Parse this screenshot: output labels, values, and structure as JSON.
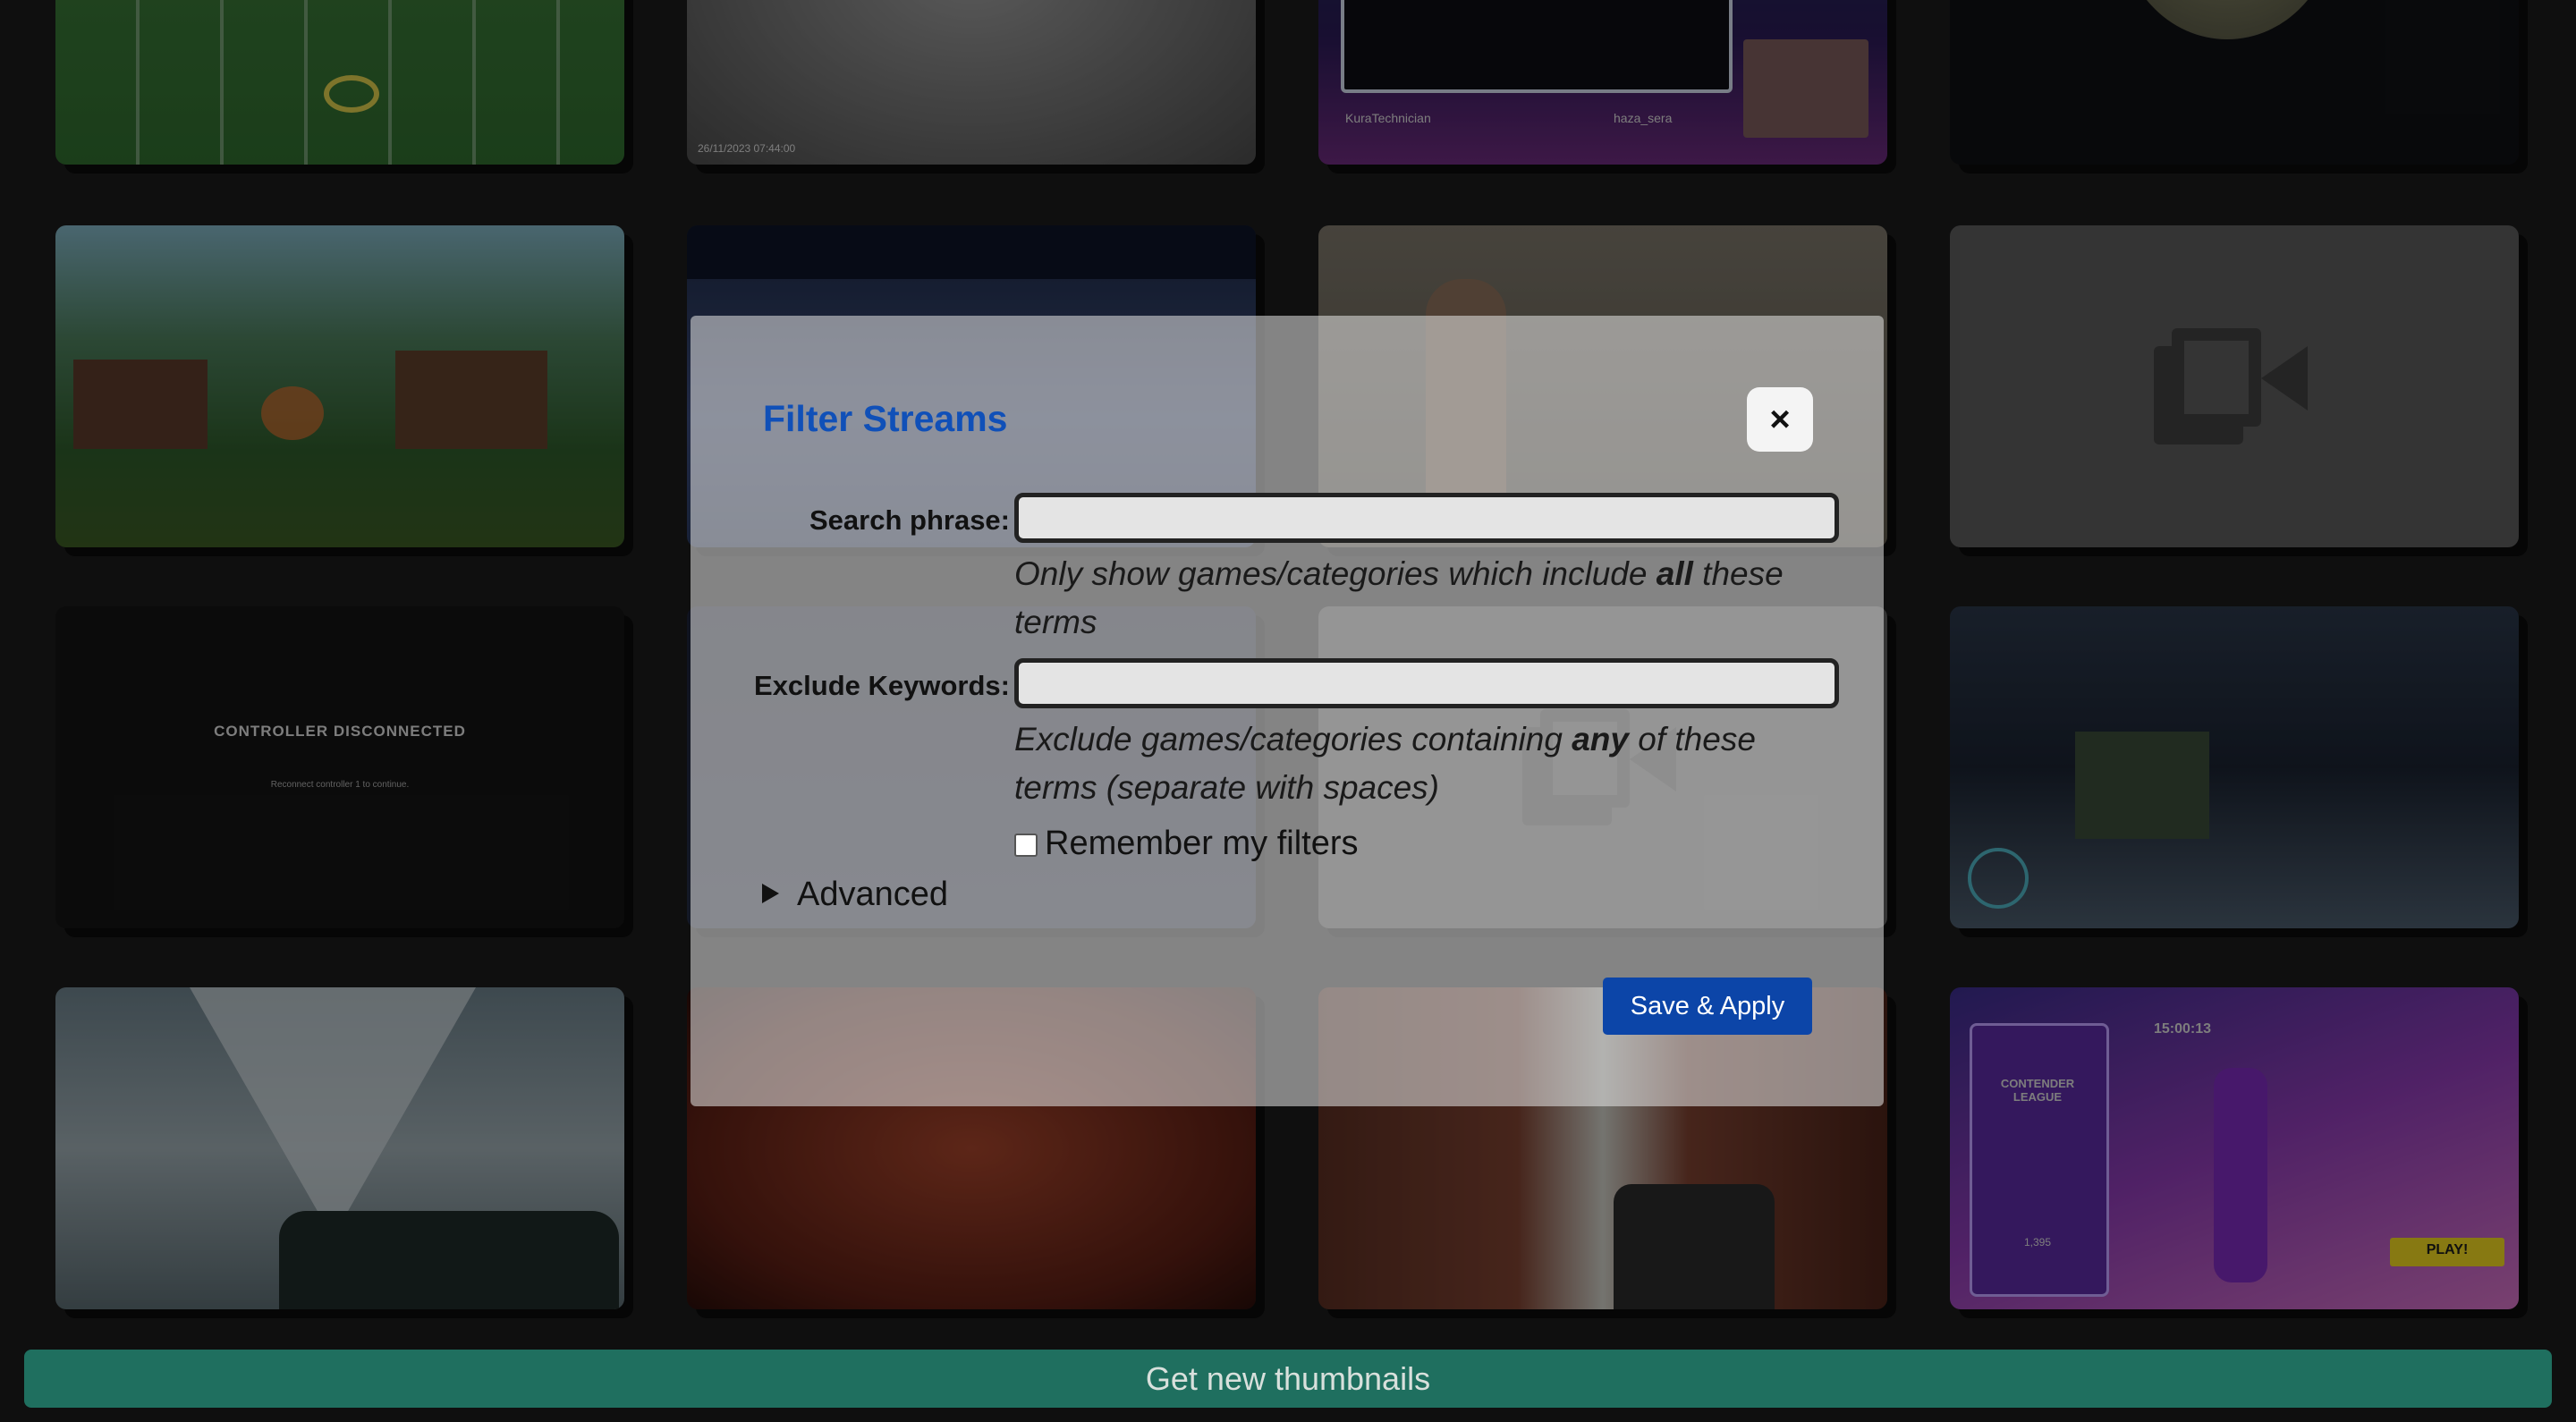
{
  "modal": {
    "title": "Filter Streams",
    "close_label": "×",
    "search_label": "Search phrase:",
    "search_value": "",
    "search_hint_pre": "Only show games/categories which include ",
    "search_hint_em": "all",
    "search_hint_post": " these terms",
    "exclude_label": "Exclude Keywords:",
    "exclude_value": "",
    "exclude_hint_pre": "Exclude games/categories containing ",
    "exclude_hint_em": "any",
    "exclude_hint_post": " of these terms (separate with spaces)",
    "remember_label": "Remember my filters",
    "remember_checked": false,
    "advanced_label": "Advanced",
    "save_label": "Save & Apply"
  },
  "footer": {
    "refresh_label": "Get new thumbnails"
  },
  "thumbnails": {
    "controller_title": "CONTROLLER DISCONNECTED",
    "controller_sub": "Reconnect controller 1 to continue.",
    "timestamp": "26/11/2023 07:44:00",
    "viewer_name_1": "KuraTechnician",
    "viewer_name_2": "haza_sera",
    "league_title": "CONTENDER LEAGUE",
    "league_points": "1,395",
    "clock": "15:00:13",
    "play_label": "PLAY!"
  },
  "colors": {
    "accent": "#0c45a8",
    "title": "#1050b8",
    "footer_bar": "#1f6f5f",
    "placeholder_tile": "#5a5a5a"
  }
}
